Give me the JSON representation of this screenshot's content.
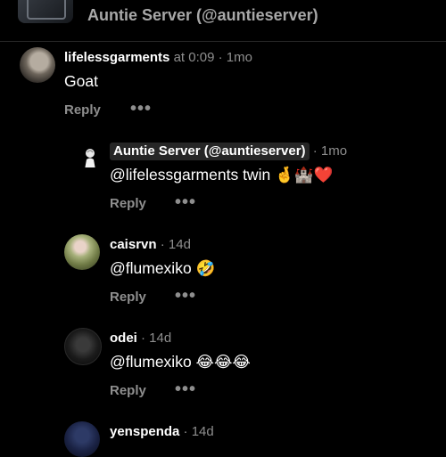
{
  "header": {
    "title": "Auntie Server (@auntieserver)"
  },
  "comments": [
    {
      "user": "lifelessgarments",
      "time": "at 0:09 · 1mo",
      "text": "Goat",
      "reply": "Reply",
      "more": "•••"
    },
    {
      "user": "Auntie Server (@auntieserver)",
      "time": " · 1mo",
      "text": "@lifelessgarments twin 🤞🏰❤️",
      "reply": "Reply",
      "more": "•••"
    },
    {
      "user": "caisrvn",
      "time": "· 14d",
      "text": "@flumexiko 🤣",
      "reply": "Reply",
      "more": "•••"
    },
    {
      "user": "odei",
      "time": "· 14d",
      "text": "@flumexiko 😂😂😂",
      "reply": "Reply",
      "more": "•••"
    },
    {
      "user": "yenspenda",
      "time": "· 14d"
    }
  ]
}
